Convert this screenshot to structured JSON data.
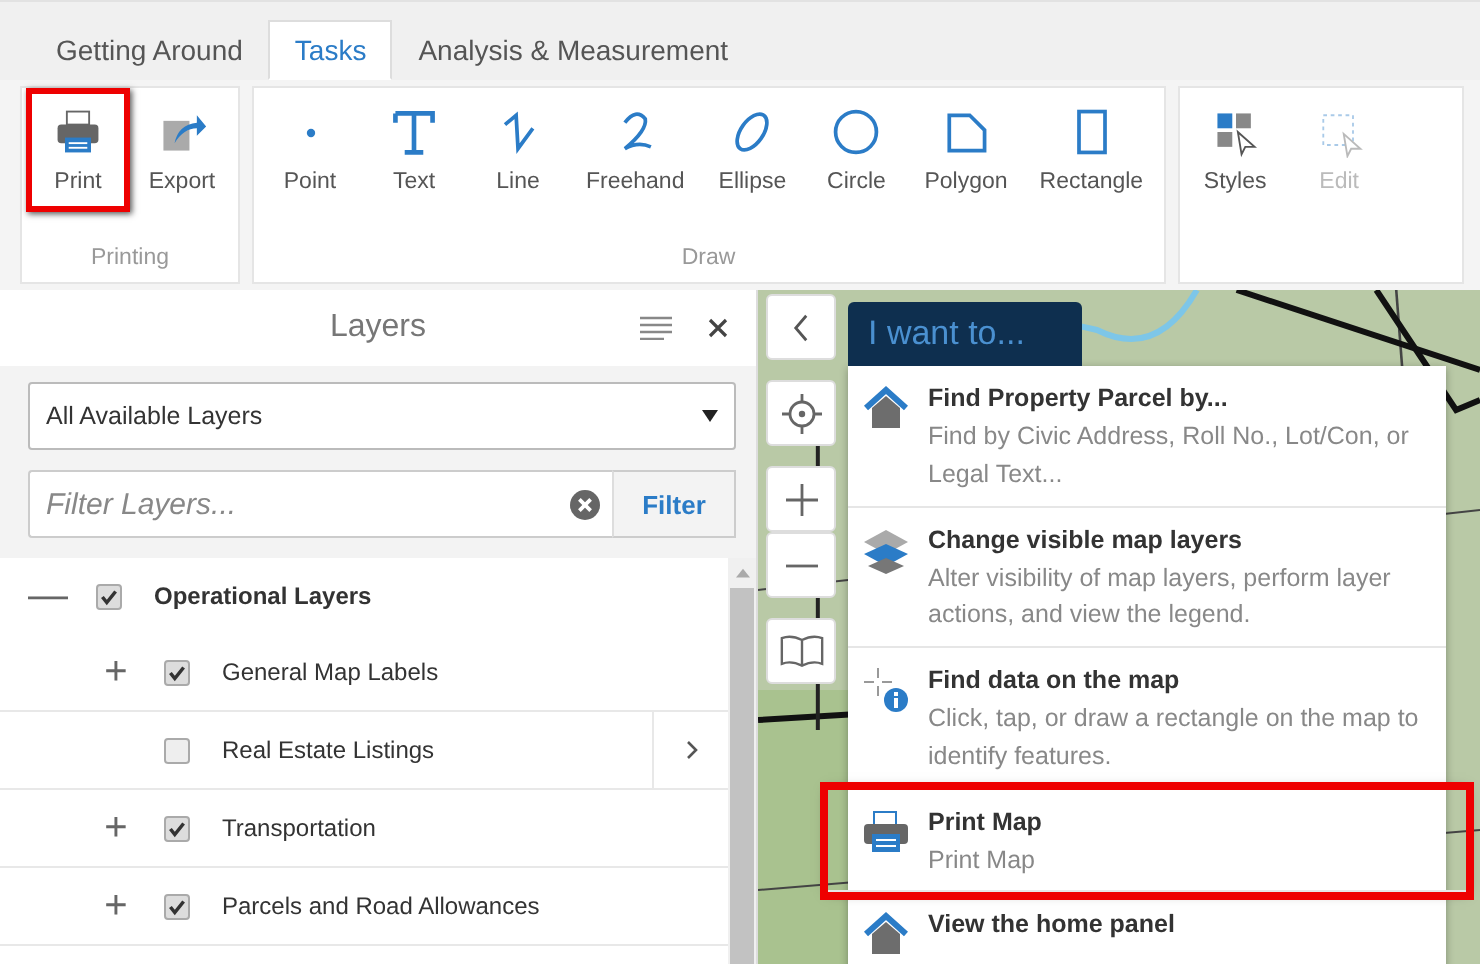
{
  "tabs": [
    {
      "label": "Getting Around",
      "selected": false
    },
    {
      "label": "Tasks",
      "selected": true
    },
    {
      "label": "Analysis & Measurement",
      "selected": false
    }
  ],
  "ribbon": {
    "groups": [
      {
        "label": "Printing",
        "tools": [
          {
            "label": "Print",
            "kind": "print",
            "disabled": false,
            "highlighted": true
          },
          {
            "label": "Export",
            "kind": "export",
            "disabled": false,
            "highlighted": false
          }
        ]
      },
      {
        "label": "Draw",
        "tools": [
          {
            "label": "Point",
            "kind": "point",
            "disabled": false,
            "highlighted": false
          },
          {
            "label": "Text",
            "kind": "text",
            "disabled": false,
            "highlighted": false
          },
          {
            "label": "Line",
            "kind": "line",
            "disabled": false,
            "highlighted": false
          },
          {
            "label": "Freehand",
            "kind": "freehand",
            "disabled": false,
            "highlighted": false
          },
          {
            "label": "Ellipse",
            "kind": "ellipse",
            "disabled": false,
            "highlighted": false
          },
          {
            "label": "Circle",
            "kind": "circle",
            "disabled": false,
            "highlighted": false
          },
          {
            "label": "Polygon",
            "kind": "polygon",
            "disabled": false,
            "highlighted": false
          },
          {
            "label": "Rectangle",
            "kind": "rectangle",
            "disabled": false,
            "highlighted": false
          }
        ]
      },
      {
        "tools": [
          {
            "label": "Styles",
            "kind": "styles",
            "disabled": false,
            "highlighted": false
          },
          {
            "label": "Edit",
            "kind": "edit",
            "disabled": true,
            "highlighted": false
          }
        ]
      }
    ]
  },
  "layers_panel": {
    "title": "Layers",
    "layer_select": {
      "value": "All Available Layers"
    },
    "filter": {
      "placeholder": "Filter Layers...",
      "button": "Filter"
    },
    "tree": [
      {
        "label": "Operational Layers",
        "expander": "—",
        "checked": true,
        "has_details": false,
        "children": [
          {
            "label": "General Map Labels",
            "expander": "+",
            "checked": true,
            "has_details": false
          },
          {
            "label": "Real Estate Listings",
            "checked": false,
            "has_details": true
          },
          {
            "label": "Transportation",
            "expander": "+",
            "checked": true,
            "has_details": false
          },
          {
            "label": "Parcels and Road Allowances",
            "expander": "+",
            "checked": true,
            "has_details": false
          }
        ]
      }
    ]
  },
  "map": {
    "i_want_to": {
      "label": "I want to...",
      "items": [
        {
          "kind": "home",
          "title": "Find Property Parcel by...",
          "description": "Find by Civic Address, Roll No., Lot/Con, or Legal Text...",
          "highlighted": false
        },
        {
          "kind": "layers",
          "title": "Change visible map layers",
          "description": "Alter visibility of map layers, perform layer actions, and view the legend.",
          "highlighted": false
        },
        {
          "kind": "identify",
          "title": "Find data on the map",
          "description": "Click, tap, or draw a rectangle on the map to identify features.",
          "highlighted": false
        },
        {
          "kind": "print",
          "title": "Print Map",
          "description": "Print Map",
          "highlighted": true
        },
        {
          "kind": "home",
          "title": "View the home panel",
          "highlighted": false
        }
      ]
    }
  }
}
